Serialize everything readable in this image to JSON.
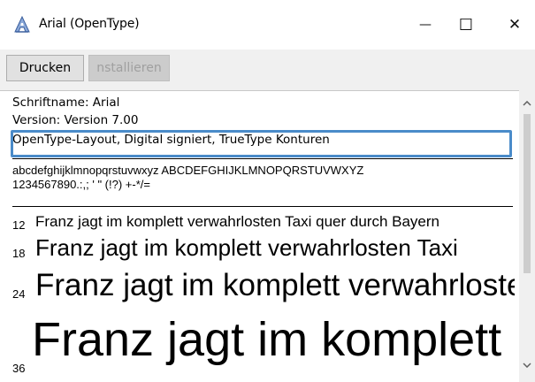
{
  "window": {
    "title": "Arial (OpenType)",
    "icon": "font-file-icon",
    "controls": {
      "minimize_glyph": "—",
      "maximize_glyph": "☐",
      "close_glyph": "✕"
    }
  },
  "toolbar": {
    "print_label": "Drucken",
    "install_label": "nstallieren"
  },
  "info": {
    "name_line": "Schriftname: Arial",
    "version_line": "Version: Version 7.00",
    "flags_line": "OpenType-Layout, Digital signiert, TrueType Konturen"
  },
  "charset": {
    "line1": "abcdefghijklmnopqrstuvwxyz ABCDEFGHIJKLMNOPQRSTUVWXYZ",
    "line2": "1234567890.:,; ' \" (!?) +-*/="
  },
  "samples": [
    {
      "size": "12",
      "text": "Franz jagt im komplett verwahrlosten Taxi quer durch Bayern"
    },
    {
      "size": "18",
      "text": "Franz jagt im komplett verwahrlosten Taxi"
    },
    {
      "size": "24",
      "text": "Franz jagt im komplett verwahrlosten"
    },
    {
      "size": "36",
      "text": "Franz jagt im komplett"
    }
  ],
  "colors": {
    "highlight": "#4a8bc9",
    "toolbar_bg": "#f0f0f0"
  }
}
